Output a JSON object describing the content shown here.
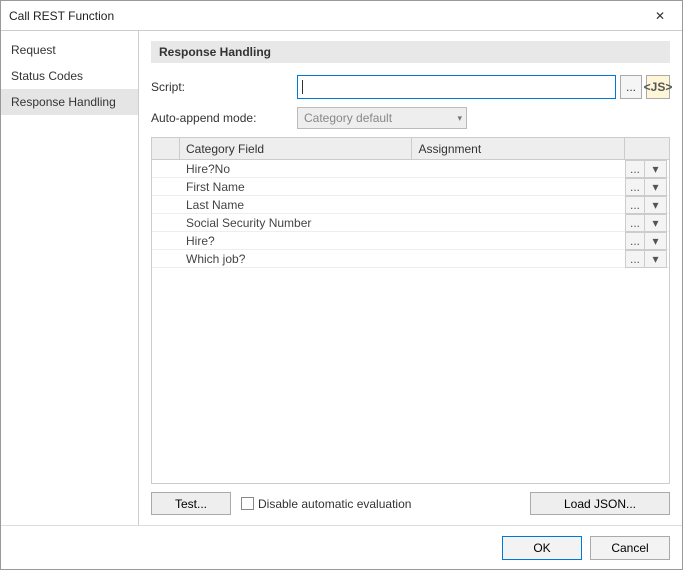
{
  "window": {
    "title": "Call REST Function"
  },
  "sidebar": {
    "items": [
      {
        "label": "Request",
        "selected": false
      },
      {
        "label": "Status Codes",
        "selected": false
      },
      {
        "label": "Response Handling",
        "selected": true
      }
    ]
  },
  "section": {
    "title": "Response Handling"
  },
  "form": {
    "script_label": "Script:",
    "script_value": "",
    "script_browse": "...",
    "js_badge": "<JS>",
    "autoappend_label": "Auto-append mode:",
    "autoappend_value": "Category default"
  },
  "table": {
    "headers": {
      "category": "Category Field",
      "assignment": "Assignment"
    },
    "rows": [
      {
        "category": "Hire?No",
        "assignment": ""
      },
      {
        "category": "First Name",
        "assignment": ""
      },
      {
        "category": "Last Name",
        "assignment": ""
      },
      {
        "category": "Social Security Number",
        "assignment": ""
      },
      {
        "category": "Hire?",
        "assignment": ""
      },
      {
        "category": "Which job?",
        "assignment": ""
      }
    ],
    "row_browse": "...",
    "row_menu": "▾"
  },
  "bottom": {
    "test": "Test...",
    "disable_auto": "Disable automatic evaluation",
    "disable_auto_checked": false,
    "load_json": "Load JSON..."
  },
  "footer": {
    "ok": "OK",
    "cancel": "Cancel"
  }
}
